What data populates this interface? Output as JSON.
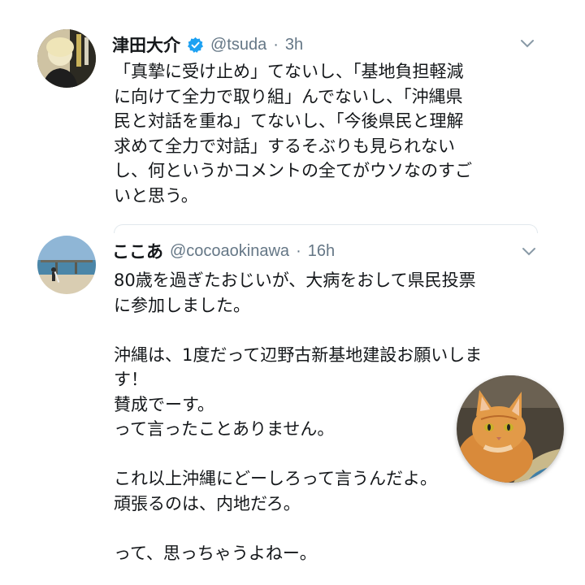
{
  "colors": {
    "verified": "#1da1f2",
    "muted": "#657786",
    "text": "#14171a"
  },
  "tweet1": {
    "author_name": "津田大介",
    "verified_icon": "verified-badge-icon",
    "handle": "@tsuda",
    "separator": "·",
    "time": "3h",
    "text": "「真摯に受け止め」てないし、「基地負担軽減\nに向けて全力で取り組」んでないし、「沖縄県\n民と対話を重ね」てないし、「今後県民と理解\n求めて全力で対話」するそぶりも見られない\nし、何というかコメントの全てがウソなのすご\nいと思う。"
  },
  "tweet2": {
    "author_name": "ここあ",
    "handle": "@cocoaokinawa",
    "separator": "·",
    "time": "16h",
    "text": "80歳を過ぎたおじいが、大病をおして県民投票\nに参加しました。\n\n沖縄は、1度だって辺野古新基地建設お願いしま\nす！\n賛成でーす。\nって言ったことありません。\n\nこれ以上沖縄にどーしろって言うんだよ。\n頑張るのは、内地だろ。\n\nって、思っちゃうよねー。"
  },
  "overlay": {
    "image": "cat-photo"
  }
}
